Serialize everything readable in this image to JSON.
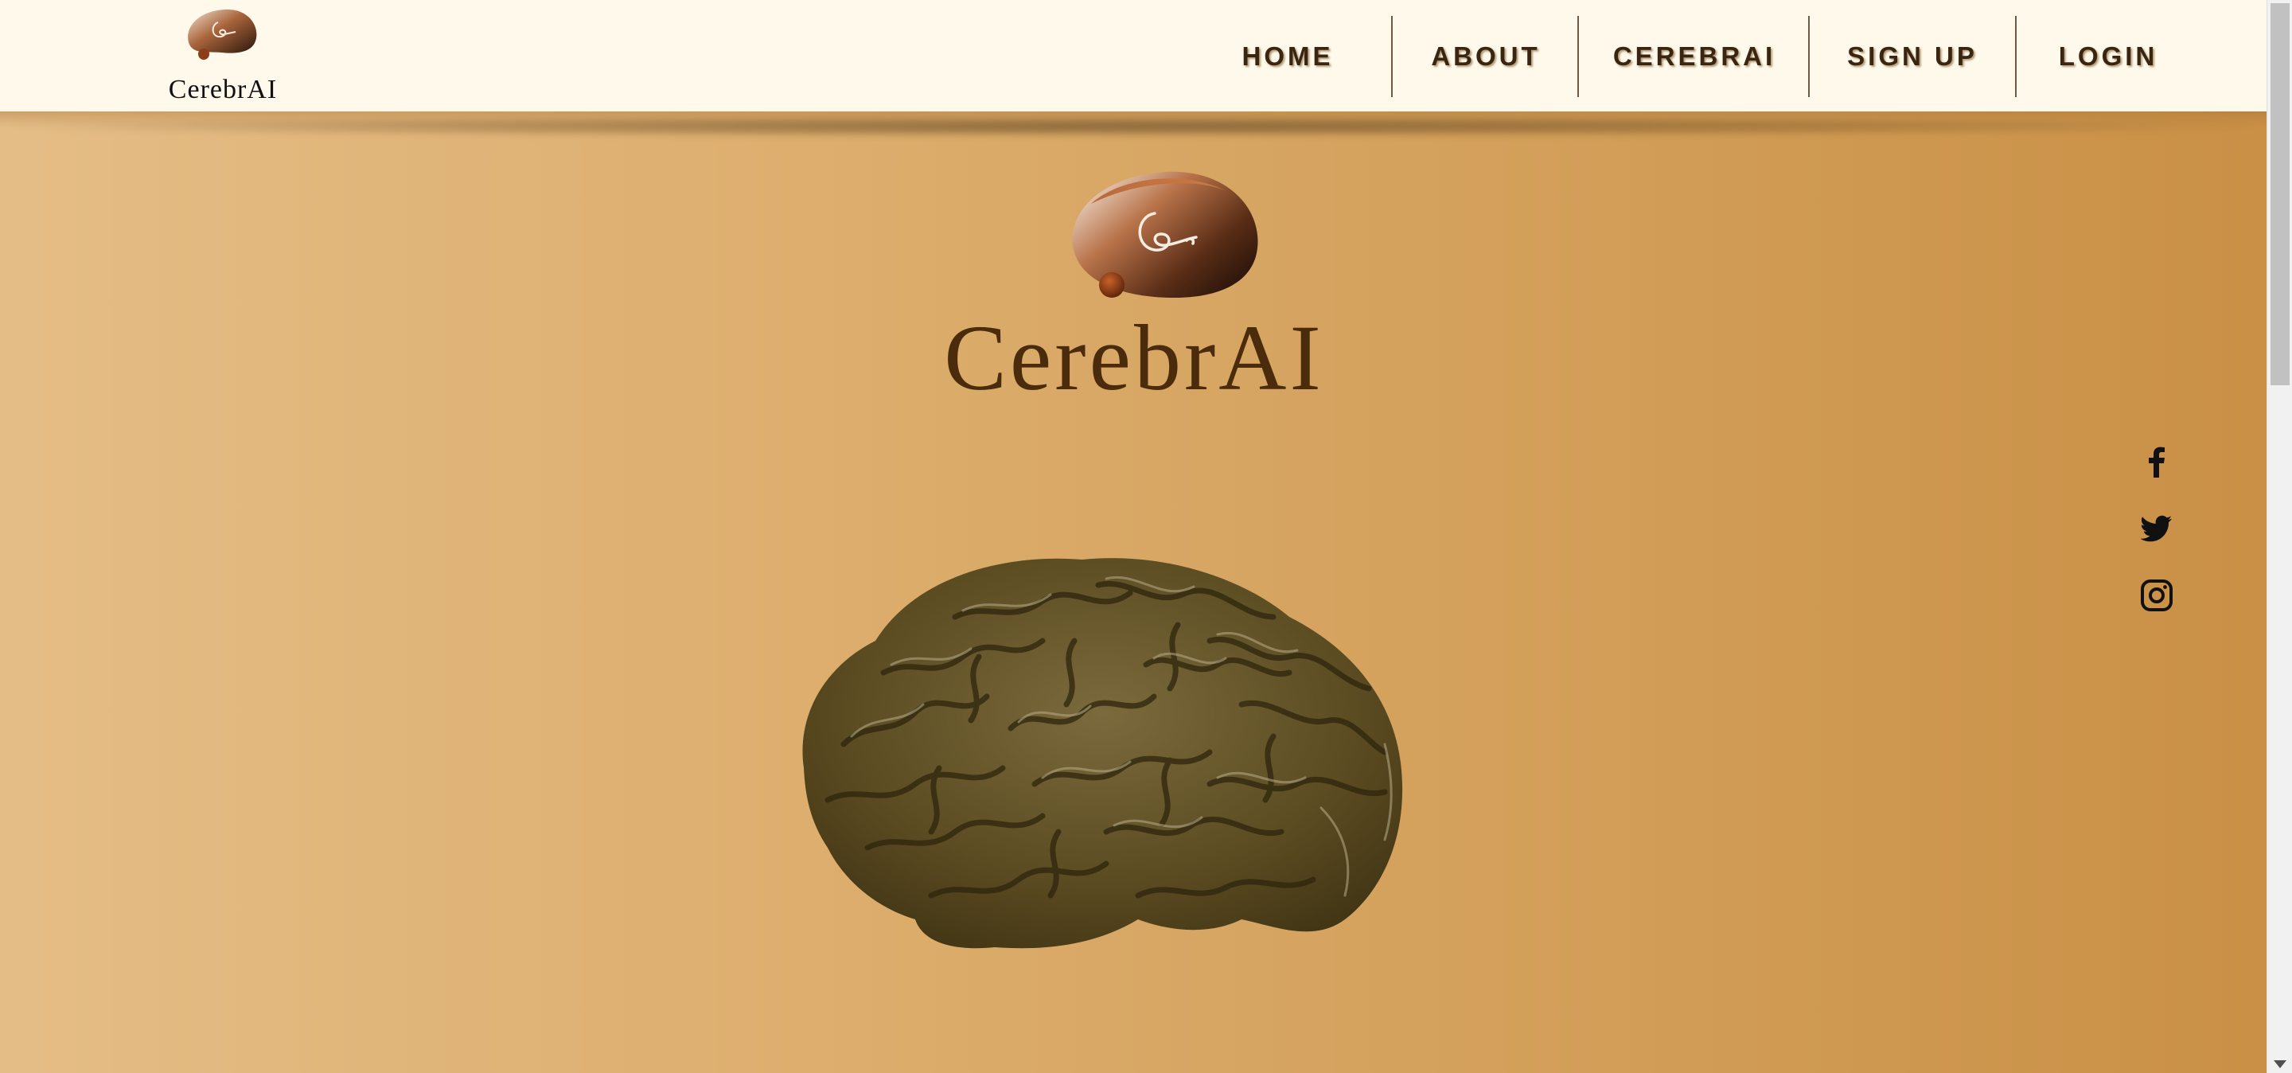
{
  "brand": {
    "name": "CerebrAI",
    "logo_icon": "brain-logo-icon"
  },
  "nav": {
    "items": [
      {
        "label": "HOME"
      },
      {
        "label": "ABOUT"
      },
      {
        "label": "CEREBRAI"
      },
      {
        "label": "SIGN UP"
      },
      {
        "label": "LOGIN"
      }
    ]
  },
  "hero": {
    "title": "CerebrAI",
    "logo_icon": "brain-logo-icon",
    "image": "brain-illustration"
  },
  "social": {
    "icons": [
      "facebook-icon",
      "twitter-icon",
      "instagram-icon"
    ]
  },
  "colors": {
    "header_bg": "#fef9ea",
    "title_color": "#4a2c0c",
    "nav_text": "#3a2412",
    "bg_light": "#e4bd86",
    "bg_dark": "#c98f45"
  }
}
